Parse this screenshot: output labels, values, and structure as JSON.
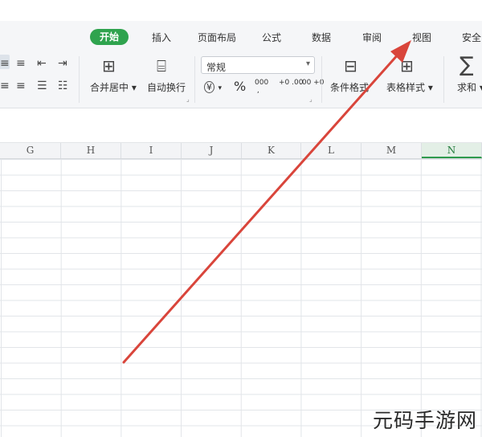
{
  "tabs": [
    {
      "label": "开始",
      "active": true
    },
    {
      "label": "插入"
    },
    {
      "label": "页面布局"
    },
    {
      "label": "公式"
    },
    {
      "label": "数据"
    },
    {
      "label": "审阅"
    },
    {
      "label": "视图"
    },
    {
      "label": "安全"
    }
  ],
  "ribbon": {
    "merge_center": "合并居中",
    "wrap_text": "自动换行",
    "number_format": "常规",
    "currency_symbol": "¥",
    "percent_symbol": "%",
    "thousands_symbol": "000",
    "increase_decimal": "+0 .00",
    "decrease_decimal": ".00 +0",
    "conditional_format": "条件格式",
    "table_style": "表格样式",
    "sum": "求和",
    "sigma_symbol": "∑"
  },
  "columns": [
    "G",
    "H",
    "I",
    "J",
    "K",
    "L",
    "M",
    "N"
  ],
  "selected_column": "N",
  "watermark": "元码手游网",
  "colors": {
    "accent": "#2fa34e",
    "arrow": "#d9453b"
  }
}
